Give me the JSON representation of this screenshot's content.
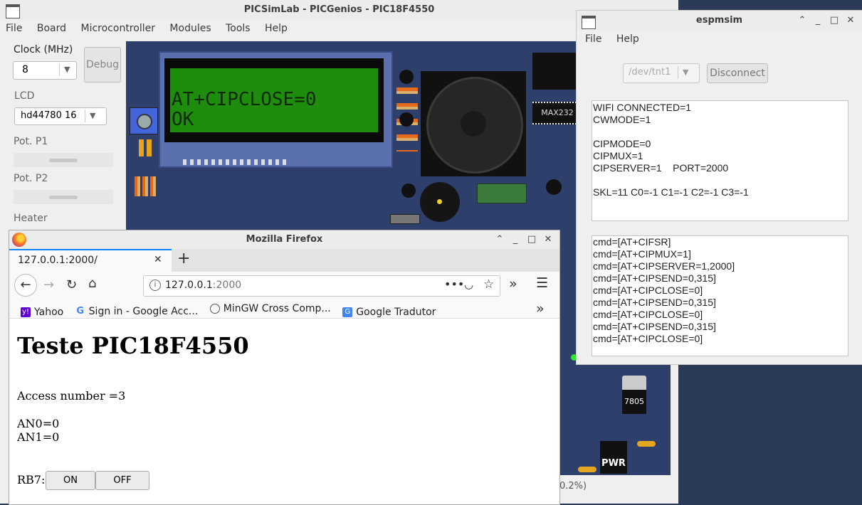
{
  "picsim": {
    "title": "PICSimLab - PICGenios - PIC18F4550",
    "menu": [
      "File",
      "Board",
      "Microcontroller",
      "Modules",
      "Tools",
      "Help"
    ],
    "clock_label": "Clock (MHz)",
    "clock_value": "8",
    "debug_label": "Debug",
    "lcd_label": "LCD",
    "lcd_value": "hd44780 16",
    "pot1_label": "Pot. P1",
    "pot2_label": "Pot. P2",
    "heater_label": "Heater",
    "lcd_line1": "AT+CIPCLOSE=0",
    "lcd_line2": "OK",
    "chip_max": "MAX232",
    "chip_7805": "7805",
    "pwr_label": "PWR",
    "status_text": "0.2%)"
  },
  "espmsim": {
    "title": "espmsim",
    "menu": [
      "File",
      "Help"
    ],
    "port_value": "/dev/tnt1",
    "disconnect_label": "Disconnect",
    "status_lines": "WIFI CONNECTED=1\nCWMODE=1\n\nCIPMODE=0\nCIPMUX=1\nCIPSERVER=1    PORT=2000\n\nSKL=11 C0=-1 C1=-1 C2=-1 C3=-1",
    "cmd_lines": "cmd=[AT+CIFSR]\ncmd=[AT+CIPMUX=1]\ncmd=[AT+CIPSERVER=1,2000]\ncmd=[AT+CIPSEND=0,315]\ncmd=[AT+CIPCLOSE=0]\ncmd=[AT+CIPSEND=0,315]\ncmd=[AT+CIPCLOSE=0]\ncmd=[AT+CIPSEND=0,315]\ncmd=[AT+CIPCLOSE=0]"
  },
  "firefox": {
    "title": "Mozilla Firefox",
    "tab_label": "127.0.0.1:2000/",
    "url_host": "127.0.0.1",
    "url_port": ":2000",
    "bookmarks": [
      "Yahoo",
      "Sign in - Google Acc...",
      "MinGW Cross Comp...",
      "Google Tradutor"
    ],
    "page_heading": "Teste PIC18F4550",
    "access_text": "Access number =3",
    "an0_text": "AN0=0",
    "an1_text": "AN1=0",
    "rb7_label": "RB7:",
    "on_label": "ON",
    "off_label": "OFF"
  },
  "colors": {
    "board_blue": "#2e3f6b",
    "lcd_green": "#1e8c0c",
    "titlebar": "#ececec"
  }
}
